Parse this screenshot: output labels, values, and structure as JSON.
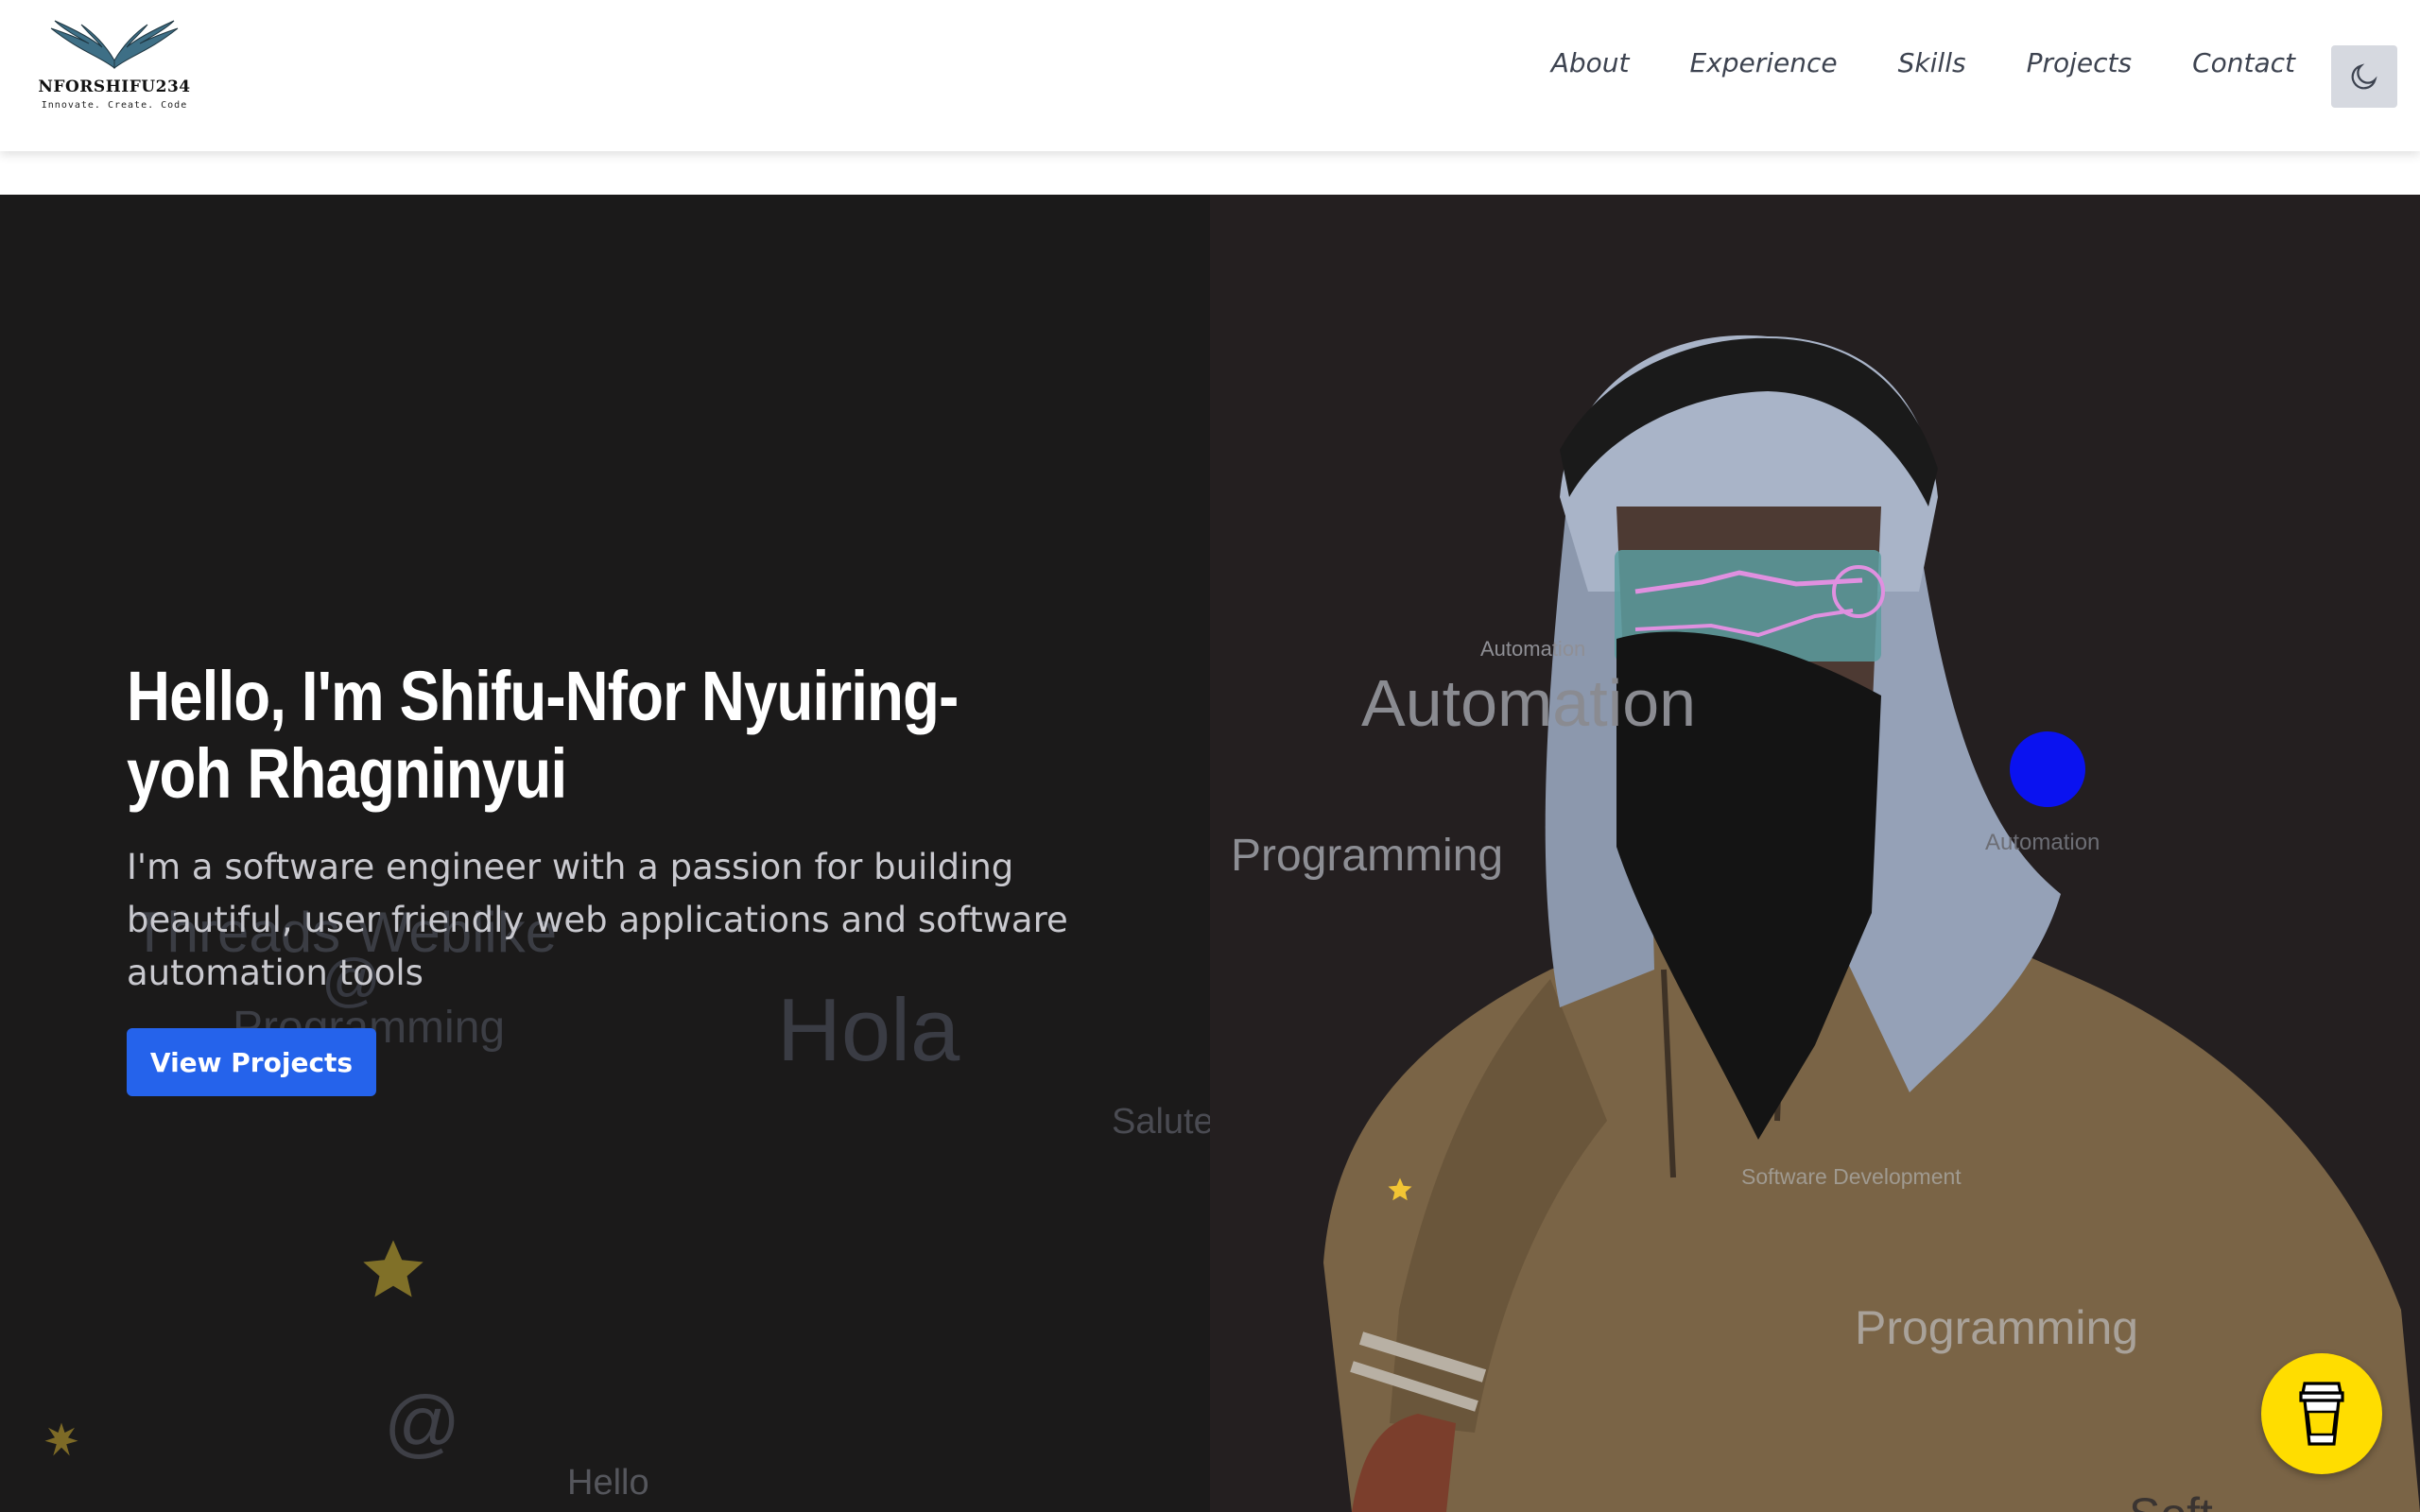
{
  "brand": {
    "name": "NFORSHIFU234",
    "tagline": "Innovate. Create. Code"
  },
  "nav": {
    "items": [
      "About",
      "Experience",
      "Skills",
      "Projects",
      "Contact"
    ],
    "theme_toggle_icon": "moon-icon"
  },
  "hero": {
    "title": "Hello, I'm Shifu-Nfor Nyuiring-yoh Rhagninyui",
    "subtitle": "I'm a software engineer with a passion for building beautiful, user friendly web applications and software automation tools",
    "cta_label": "View Projects"
  },
  "background_words": {
    "left": [
      "Threads Weblike",
      "@",
      "Programming",
      "Hola",
      "Salute",
      "@",
      "Hello"
    ],
    "right": [
      "Automation",
      "Automation",
      "Programming",
      "Automation",
      "Software Development",
      "Programming",
      "Soft"
    ]
  },
  "floating_button_icon": "coffee-cup-icon",
  "colors": {
    "accent": "#2563eb",
    "hero_bg": "#1b1a1a",
    "coffee_button": "#ffdd00",
    "orb": "#0a12f0"
  }
}
